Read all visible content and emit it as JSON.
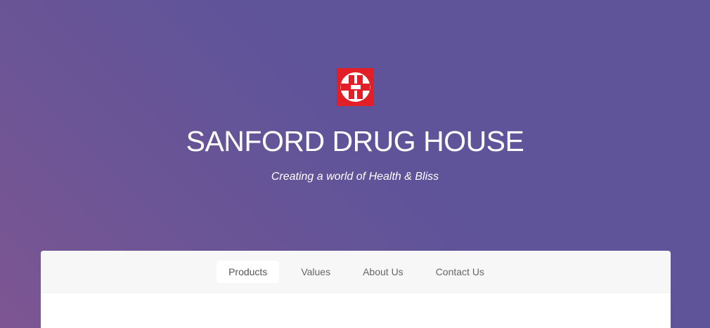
{
  "header": {
    "logo_icon": "sanford-s-logo-icon",
    "logo_color": "#e21f26",
    "title": "SANFORD DRUG HOUSE",
    "tagline": "Creating a world of Health & Bliss"
  },
  "nav": {
    "items": [
      {
        "label": "Products",
        "active": true
      },
      {
        "label": "Values",
        "active": false
      },
      {
        "label": "About Us",
        "active": false
      },
      {
        "label": "Contact Us",
        "active": false
      }
    ]
  },
  "colors": {
    "background": "#5f539a",
    "background_accent": "#7d5592",
    "nav_background": "#f7f7f7",
    "card_background": "#ffffff"
  }
}
